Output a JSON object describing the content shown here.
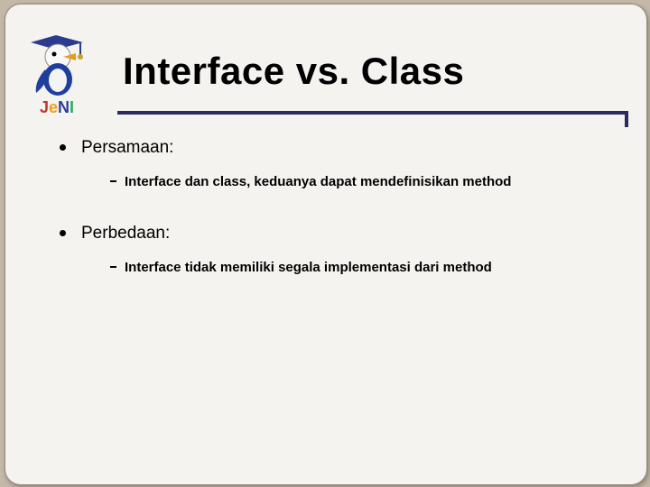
{
  "slide": {
    "title": "Interface vs. Class",
    "logo_label": "JeNI",
    "items": [
      {
        "label": "Persamaan:",
        "sub": [
          "Interface dan class, keduanya dapat mendefinisikan method"
        ]
      },
      {
        "label": "Perbedaan:",
        "sub": [
          "Interface tidak memiliki segala implementasi dari method"
        ]
      }
    ]
  }
}
